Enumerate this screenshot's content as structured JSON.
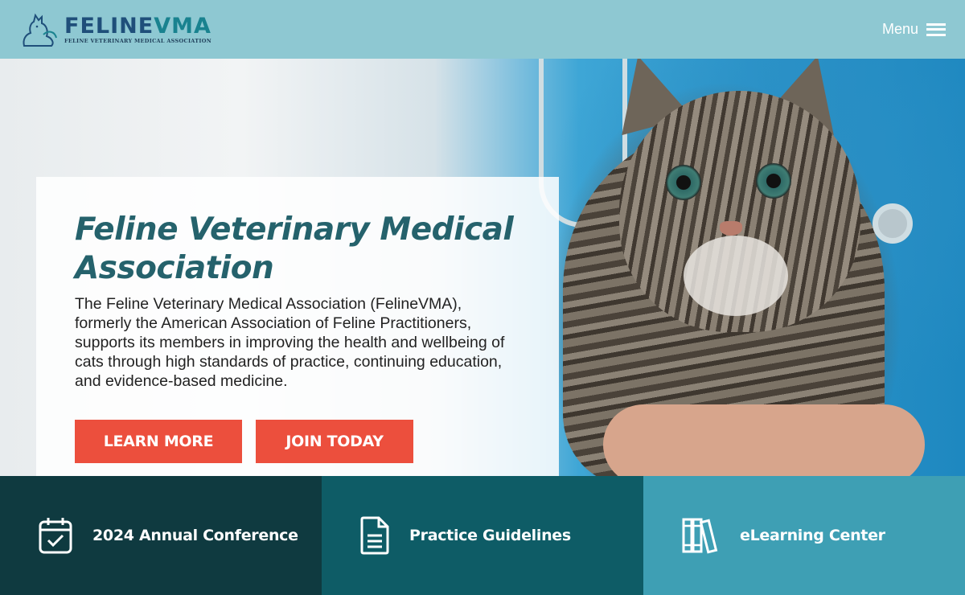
{
  "header": {
    "logo_main_a": "FELINE",
    "logo_main_b": "VMA",
    "logo_sub": "FELINE VETERINARY MEDICAL ASSOCIATION",
    "menu_label": "Menu",
    "logo_icon": "cat-logo-icon",
    "menu_icon": "hamburger-icon"
  },
  "hero": {
    "title_line1": "Feline Veterinary Medical",
    "title_line2": "Association",
    "description": "The Feline Veterinary Medical Association (FelineVMA), formerly the American Association of Feline Practitioners, supports its members in improving the health and wellbeing of cats through high standards of practice, continuing education, and evidence-based medicine.",
    "learn_more_label": "LEARN MORE",
    "join_today_label": "JOIN TODAY"
  },
  "tiles": [
    {
      "label": "2024 Annual Conference",
      "icon": "calendar-check-icon",
      "color": "#0f3a40"
    },
    {
      "label": "Practice Guidelines",
      "icon": "document-icon",
      "color": "#0e5c66"
    },
    {
      "label": "eLearning Center",
      "icon": "books-icon",
      "color": "#3e9fb4"
    }
  ],
  "colors": {
    "header_bg": "#8ec8d2",
    "accent_button": "#ec4f3d",
    "title_color": "#25626c"
  }
}
